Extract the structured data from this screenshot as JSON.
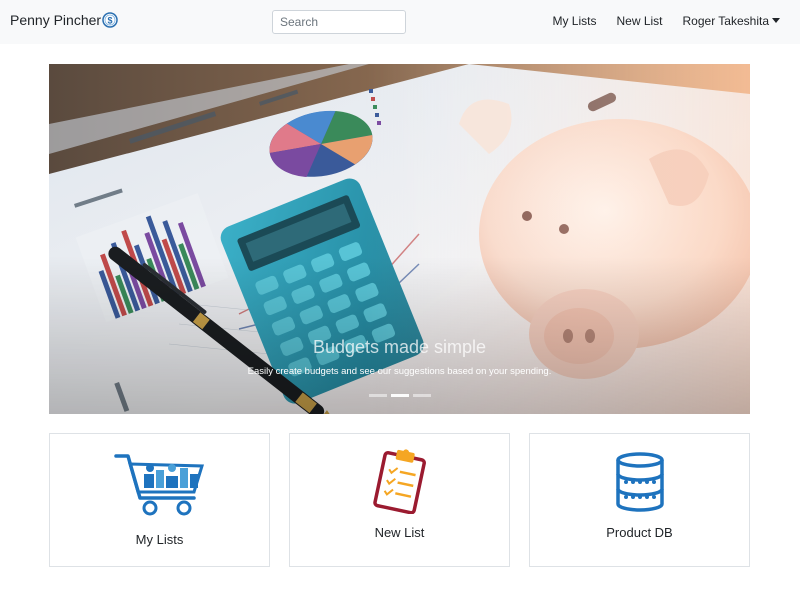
{
  "navbar": {
    "brand": "Penny Pincher",
    "brand_icon": "dollar-coin-icon",
    "search_placeholder": "Search",
    "links": [
      {
        "label": "My Lists"
      },
      {
        "label": "New List"
      },
      {
        "label": "Roger Takeshita"
      }
    ]
  },
  "carousel": {
    "caption_title": "Budgets made simple",
    "caption_text": "Easily create budgets and see our suggestions based on your spending.",
    "slide_count": 3,
    "active_slide": 2
  },
  "cards": [
    {
      "label": "My Lists",
      "icon": "shopping-cart-icon"
    },
    {
      "label": "New List",
      "icon": "clipboard-checklist-icon"
    },
    {
      "label": "Product DB",
      "icon": "database-icon"
    }
  ],
  "colors": {
    "navbar_bg": "#f8f9fa",
    "cart_blue": "#1e73be",
    "clipboard_red": "#9b1b30",
    "clipboard_orange": "#f5a623",
    "database_blue": "#1e73be"
  }
}
